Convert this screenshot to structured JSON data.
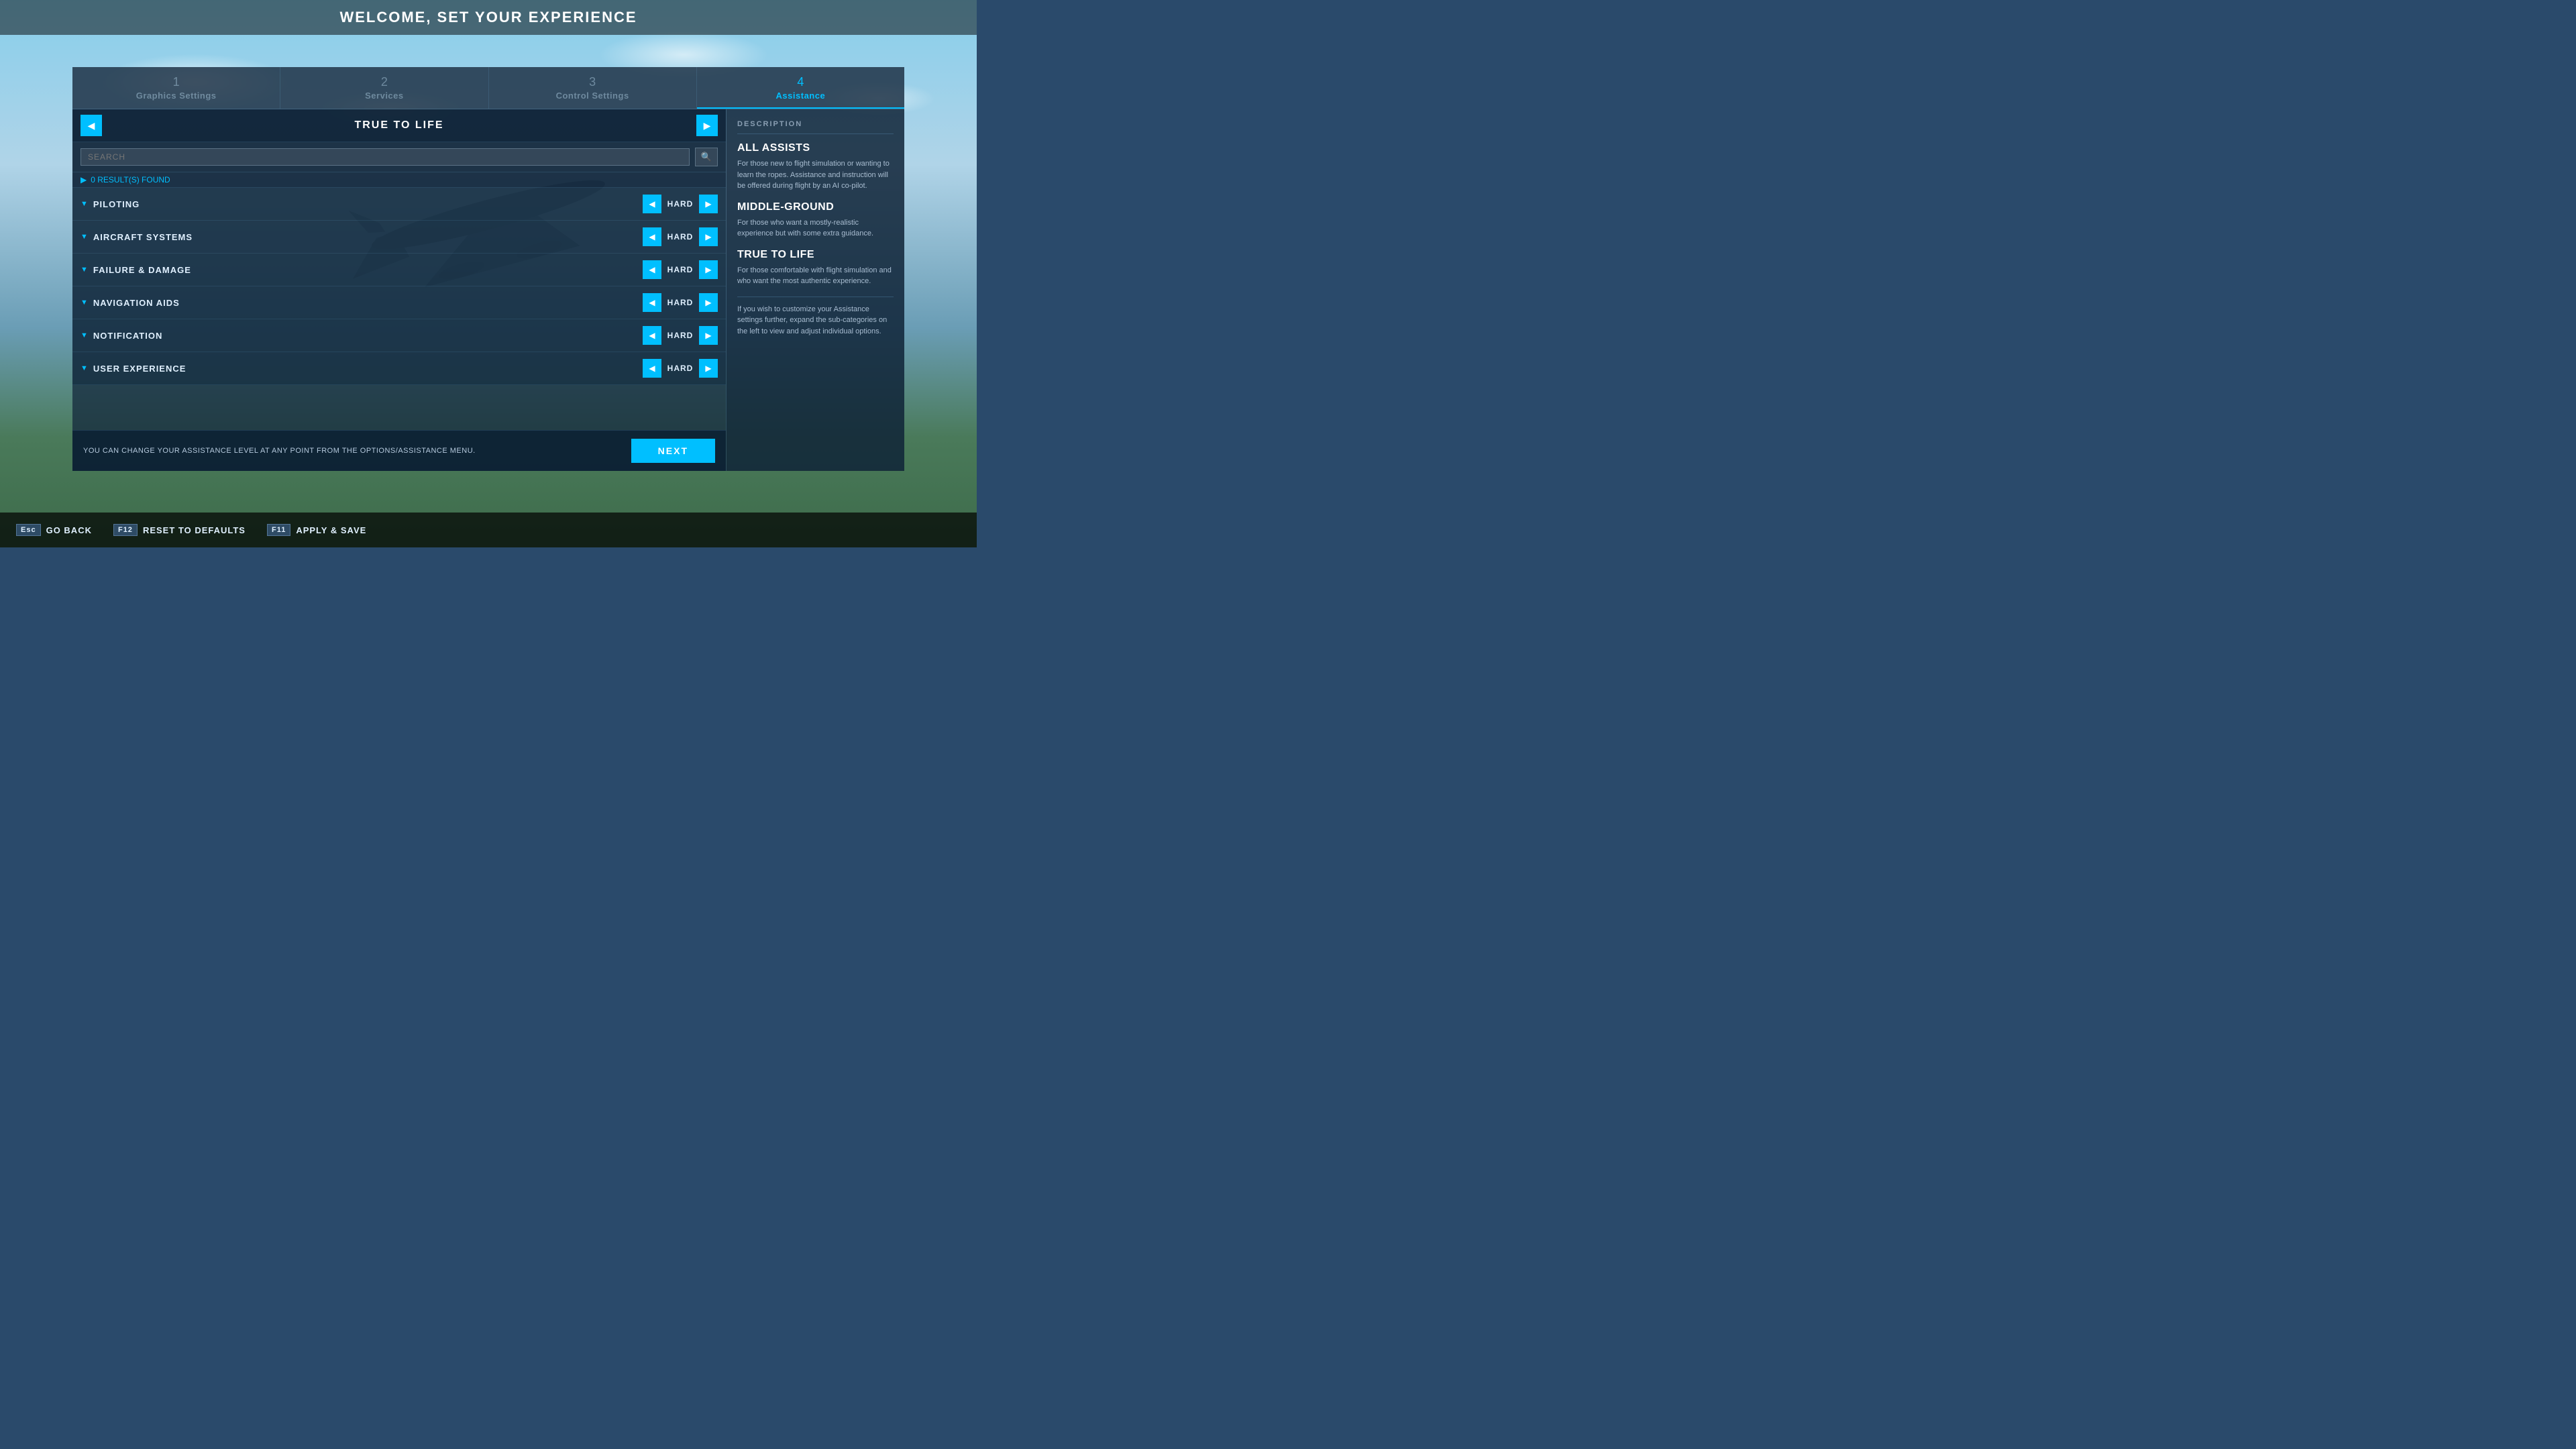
{
  "page": {
    "title": "WELCOME, SET YOUR EXPERIENCE"
  },
  "steps": [
    {
      "number": "1",
      "label": "Graphics Settings",
      "active": false
    },
    {
      "number": "2",
      "label": "Services",
      "active": false
    },
    {
      "number": "3",
      "label": "Control Settings",
      "active": false
    },
    {
      "number": "4",
      "label": "Assistance",
      "active": true
    }
  ],
  "panel": {
    "prev_arrow": "◀",
    "next_arrow": "▶",
    "title": "TRUE TO LIFE",
    "search_placeholder": "SEARCH",
    "search_result": "0 RESULT(S) FOUND"
  },
  "categories": [
    {
      "name": "PILOTING",
      "value": "HARD"
    },
    {
      "name": "AIRCRAFT SYSTEMS",
      "value": "HARD"
    },
    {
      "name": "FAILURE & DAMAGE",
      "value": "HARD"
    },
    {
      "name": "NAVIGATION AIDS",
      "value": "HARD"
    },
    {
      "name": "NOTIFICATION",
      "value": "HARD"
    },
    {
      "name": "USER EXPERIENCE",
      "value": "HARD"
    }
  ],
  "description": {
    "section_title": "DESCRIPTION",
    "entries": [
      {
        "heading": "ALL ASSISTS",
        "text": "For those new to flight simulation or wanting to learn the ropes. Assistance and instruction will be offered during flight by an AI co-pilot."
      },
      {
        "heading": "MIDDLE-GROUND",
        "text": "For those who want a mostly-realistic experience but with some extra guidance."
      },
      {
        "heading": "TRUE TO LIFE",
        "text": "For those comfortable with flight simulation and who want the most authentic experience."
      },
      {
        "heading": "",
        "text": "If you wish to customize your Assistance settings further, expand the sub-categories on the left to view and adjust individual options."
      }
    ]
  },
  "info_bar": {
    "text": "YOU CAN CHANGE YOUR ASSISTANCE LEVEL AT ANY POINT FROM THE OPTIONS/ASSISTANCE MENU.",
    "next_label": "NEXT"
  },
  "bottom_bar": [
    {
      "key": "Esc",
      "label": "GO BACK"
    },
    {
      "key": "F12",
      "label": "RESET TO DEFAULTS"
    },
    {
      "key": "F11",
      "label": "APPLY & SAVE"
    }
  ]
}
